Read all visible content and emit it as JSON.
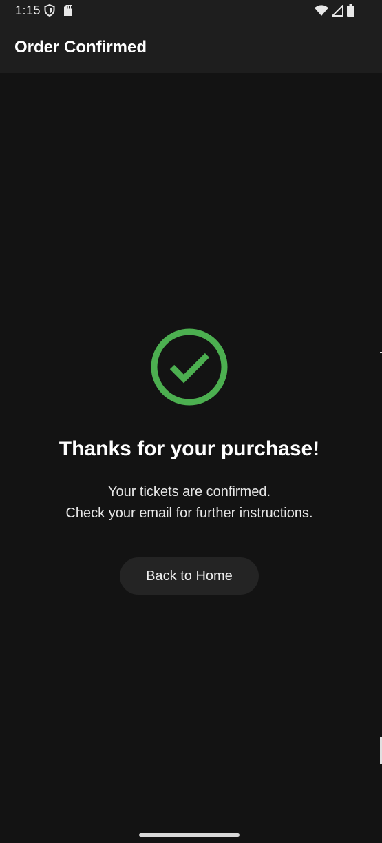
{
  "status_bar": {
    "time": "1:15",
    "icons": [
      "shield-icon",
      "sd-card-icon",
      "wifi-icon",
      "signal-icon",
      "battery-icon"
    ]
  },
  "app_bar": {
    "title": "Order Confirmed"
  },
  "confirmation": {
    "icon": "check-circle-icon",
    "icon_color": "#4caf50",
    "headline": "Thanks for your purchase!",
    "line1": "Your tickets are confirmed.",
    "line2": "Check your email for further instructions."
  },
  "actions": {
    "back_home_label": "Back to Home"
  },
  "colors": {
    "background": "#131313",
    "app_bar": "#1e1e1e",
    "button": "#242424",
    "accent": "#4caf50"
  }
}
